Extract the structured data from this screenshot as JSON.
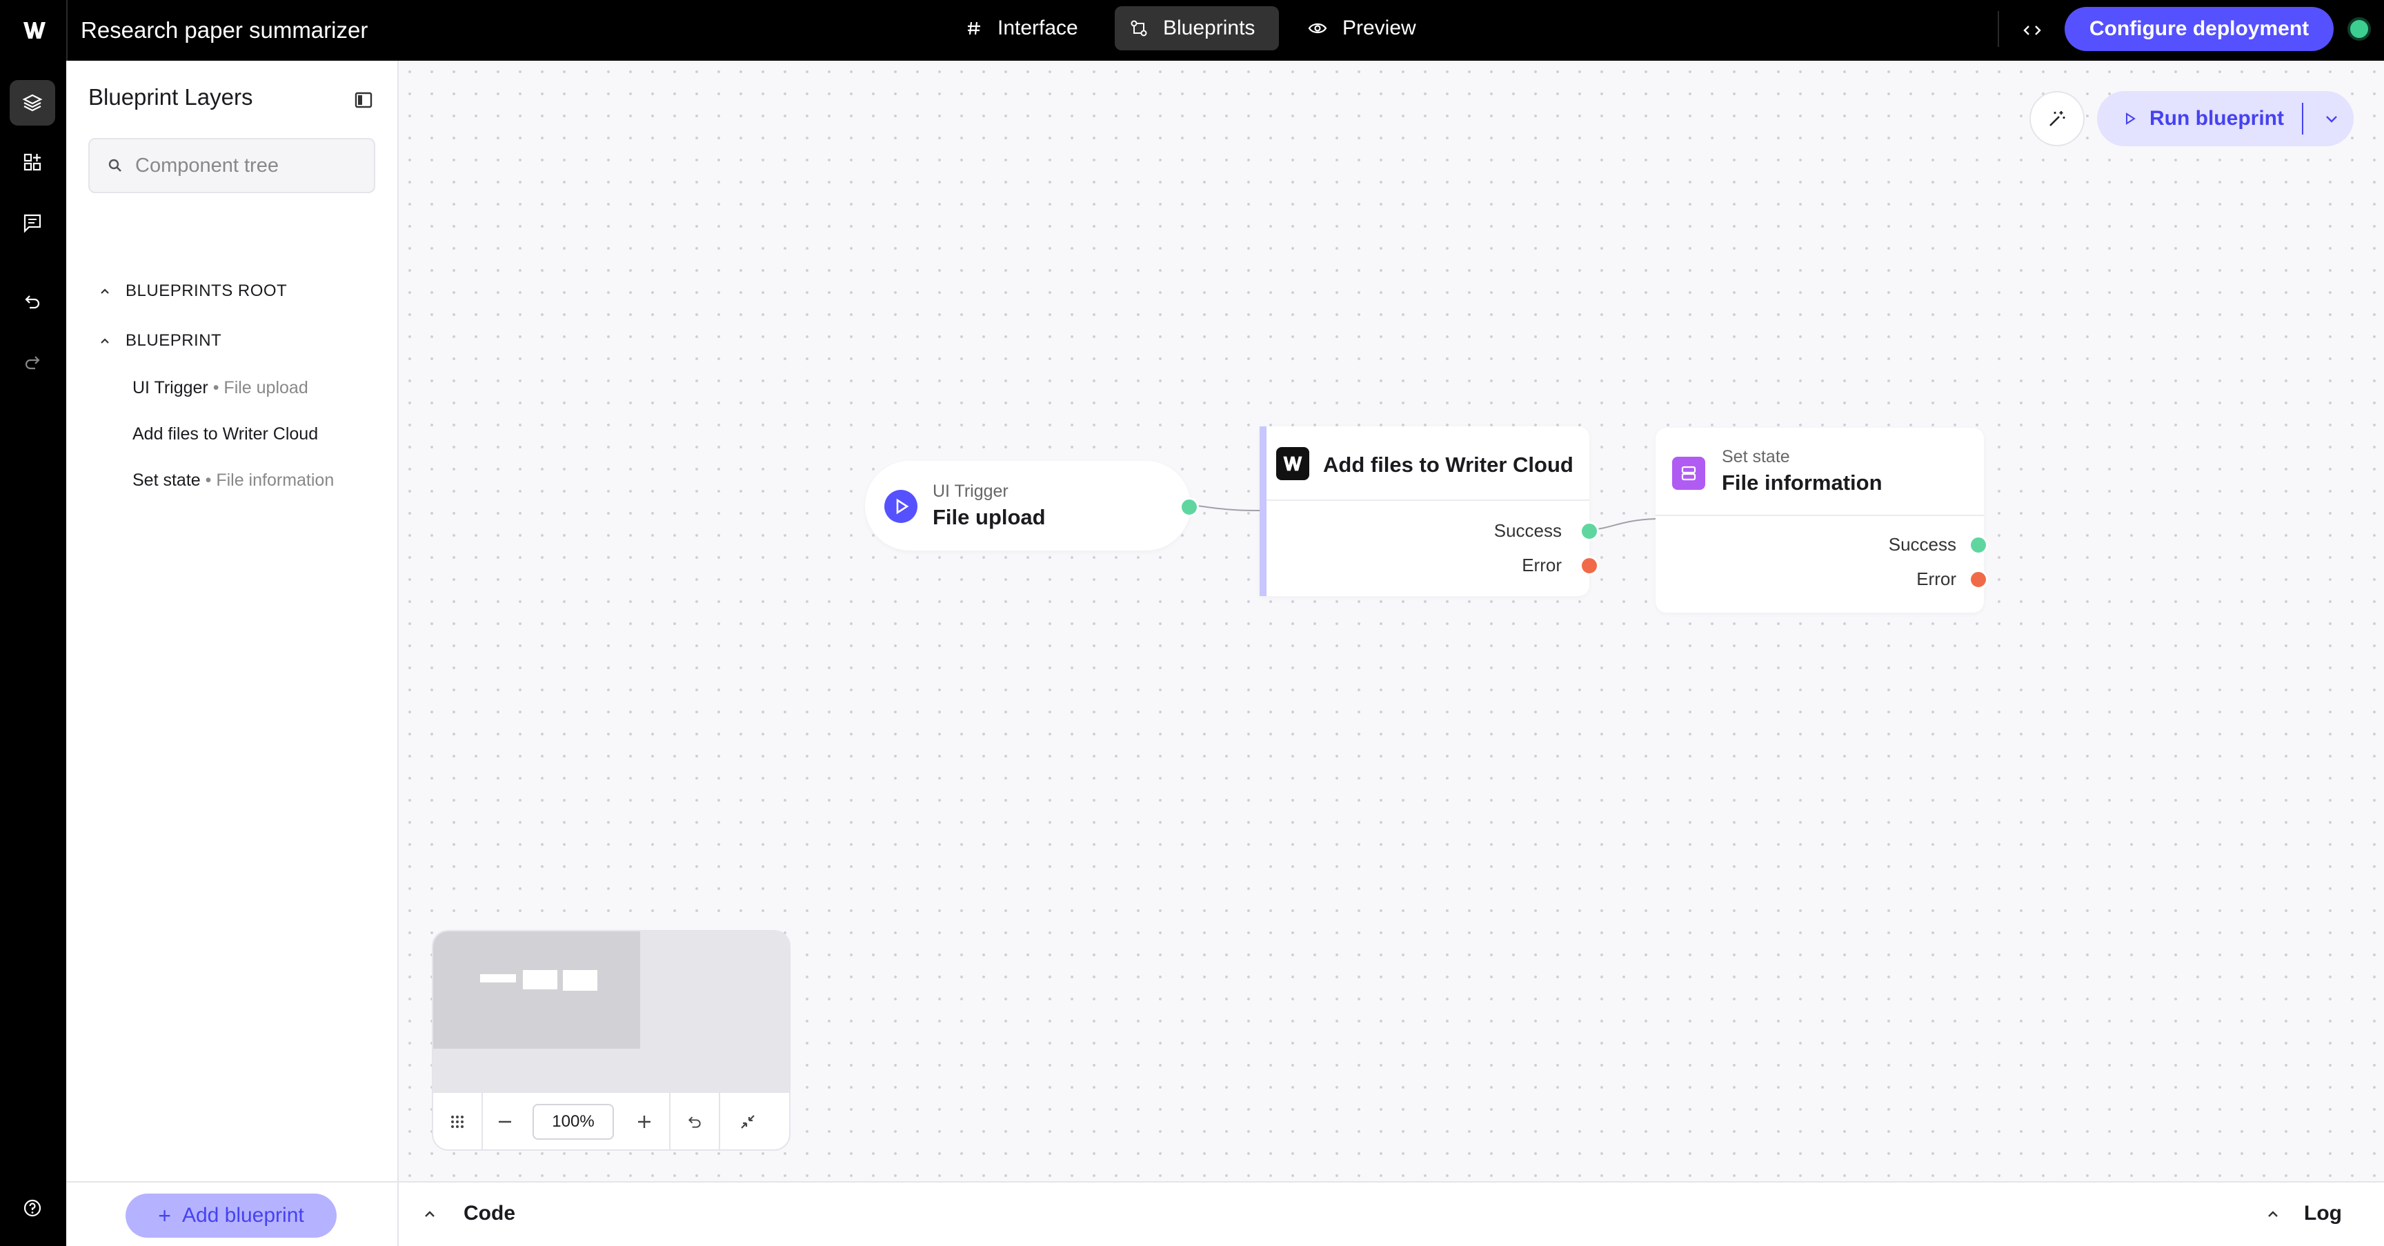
{
  "app": {
    "title": "Research paper summarizer",
    "status_color": "#3ccf91",
    "accent_color": "#5551ff"
  },
  "topbar": {
    "tabs": [
      {
        "label": "Interface",
        "icon": "hash-icon",
        "active": false
      },
      {
        "label": "Blueprints",
        "icon": "blueprint-icon",
        "active": true
      },
      {
        "label": "Preview",
        "icon": "eye-icon",
        "active": false
      }
    ],
    "deploy_label": "Configure deployment"
  },
  "rail": {
    "items": [
      "layers-icon",
      "add-component-icon",
      "comment-icon",
      "undo-icon",
      "redo-icon",
      "help-icon"
    ]
  },
  "layers": {
    "title": "Blueprint Layers",
    "search_placeholder": "Component tree",
    "root_label": "BLUEPRINTS ROOT",
    "blueprint_label": "BLUEPRINT",
    "items": [
      {
        "name": "UI Trigger",
        "sub": "File upload"
      },
      {
        "name": "Add files to Writer Cloud",
        "sub": ""
      },
      {
        "name": "Set state",
        "sub": "File information"
      }
    ],
    "add_label": "Add blueprint"
  },
  "canvas": {
    "run_label": "Run blueprint",
    "nodes": {
      "trigger": {
        "type": "UI Trigger",
        "title": "File upload"
      },
      "writer": {
        "title": "Add files to Writer Cloud",
        "success": "Success",
        "error": "Error"
      },
      "state": {
        "type": "Set state",
        "title": "File information",
        "success": "Success",
        "error": "Error"
      }
    },
    "zoom": "100%"
  },
  "bottom": {
    "code_label": "Code",
    "log_label": "Log"
  }
}
